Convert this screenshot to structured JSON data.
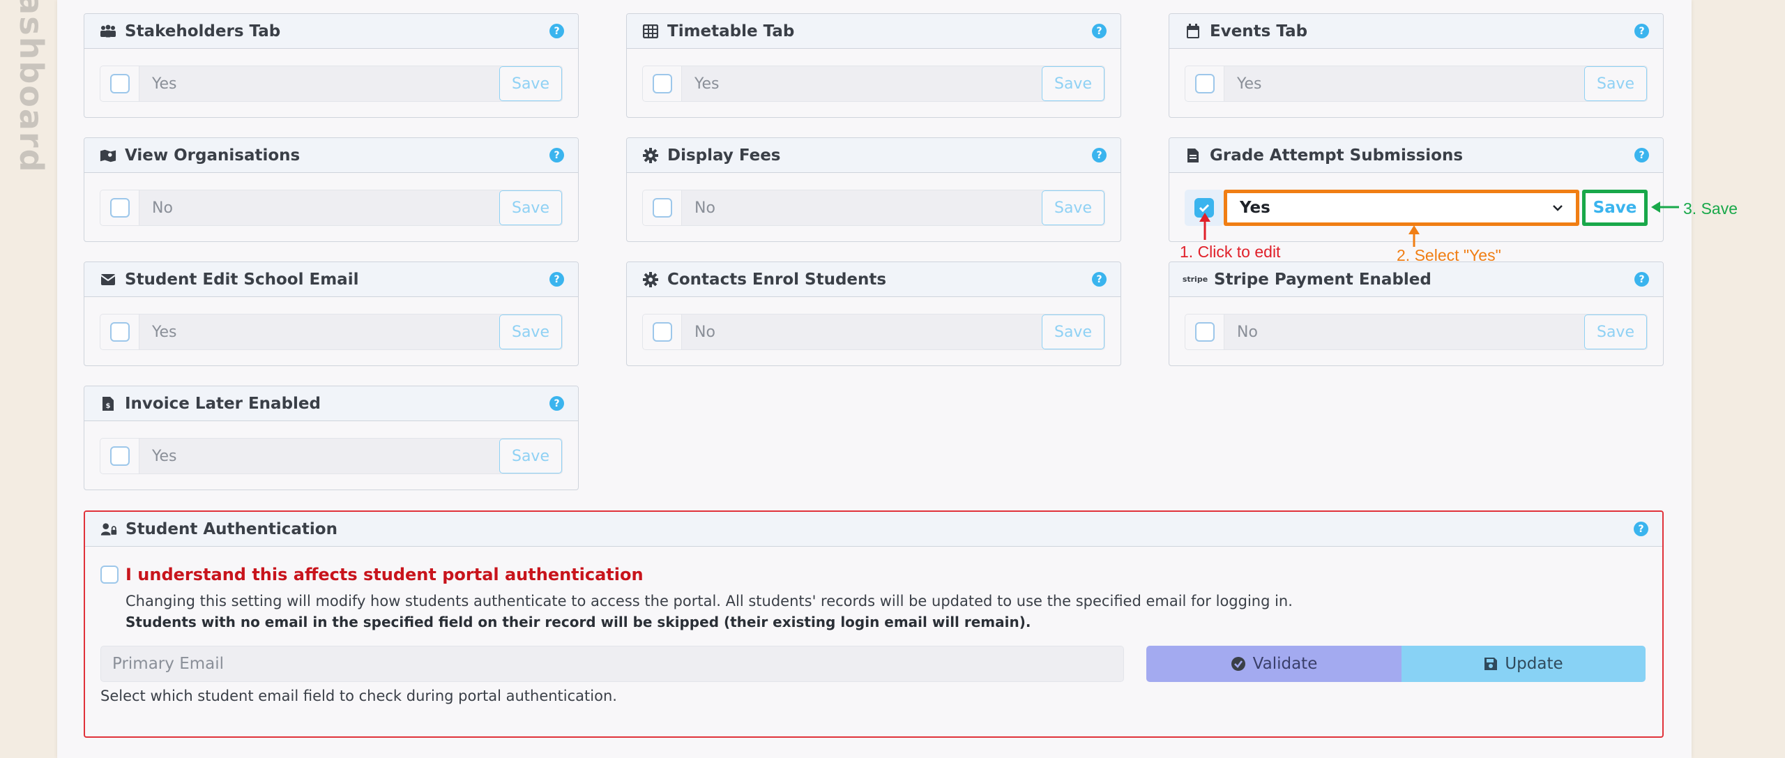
{
  "sidebar": {
    "vertical_label": "Dashboard"
  },
  "cards": [
    {
      "title": "Stakeholders Tab",
      "icon": "users-icon",
      "value": "Yes",
      "save_label": "Save",
      "help": "?"
    },
    {
      "title": "Timetable Tab",
      "icon": "table-icon",
      "value": "Yes",
      "save_label": "Save",
      "help": "?"
    },
    {
      "title": "Events Tab",
      "icon": "calendar-icon",
      "value": "Yes",
      "save_label": "Save",
      "help": "?"
    },
    {
      "title": "View Organisations",
      "icon": "map-icon",
      "value": "No",
      "save_label": "Save",
      "help": "?"
    },
    {
      "title": "Display Fees",
      "icon": "gear-icon",
      "value": "No",
      "save_label": "Save",
      "help": "?"
    },
    {
      "title": "Grade Attempt Submissions",
      "icon": "file-icon",
      "value": "Yes",
      "save_label": "Save",
      "help": "?"
    },
    {
      "title": "Student Edit School Email",
      "icon": "envelope-icon",
      "value": "Yes",
      "save_label": "Save",
      "help": "?"
    },
    {
      "title": "Contacts Enrol Students",
      "icon": "gear-icon",
      "value": "No",
      "save_label": "Save",
      "help": "?"
    },
    {
      "title": "Stripe Payment Enabled",
      "icon": "stripe-icon",
      "icon_text": "stripe",
      "value": "No",
      "save_label": "Save",
      "help": "?"
    },
    {
      "title": "Invoice Later Enabled",
      "icon": "invoice-icon",
      "value": "Yes",
      "save_label": "Save",
      "help": "?"
    }
  ],
  "annotations": {
    "step1": "1. Click to edit",
    "step2": "2. Select \"Yes\"",
    "step3": "3. Save",
    "colors": {
      "step1": "#e0202a",
      "step2": "#f07e14",
      "step3": "#19a84a"
    }
  },
  "auth": {
    "title": "Student Authentication",
    "help": "?",
    "understand_label": "I understand this affects student portal authentication",
    "description": "Changing this setting will modify how students authenticate to access the portal. All students' records will be updated to use the specified email for logging in.",
    "warning": "Students with no email in the specified field on their record will be skipped (their existing login email will remain).",
    "email_value": "Primary Email",
    "validate_label": "Validate",
    "update_label": "Update",
    "hint": "Select which student email field to check during portal authentication."
  },
  "colors": {
    "accent": "#3ab4ee",
    "danger": "#c8141c",
    "validate": "#a3aaf0",
    "update": "#88d2f5"
  }
}
